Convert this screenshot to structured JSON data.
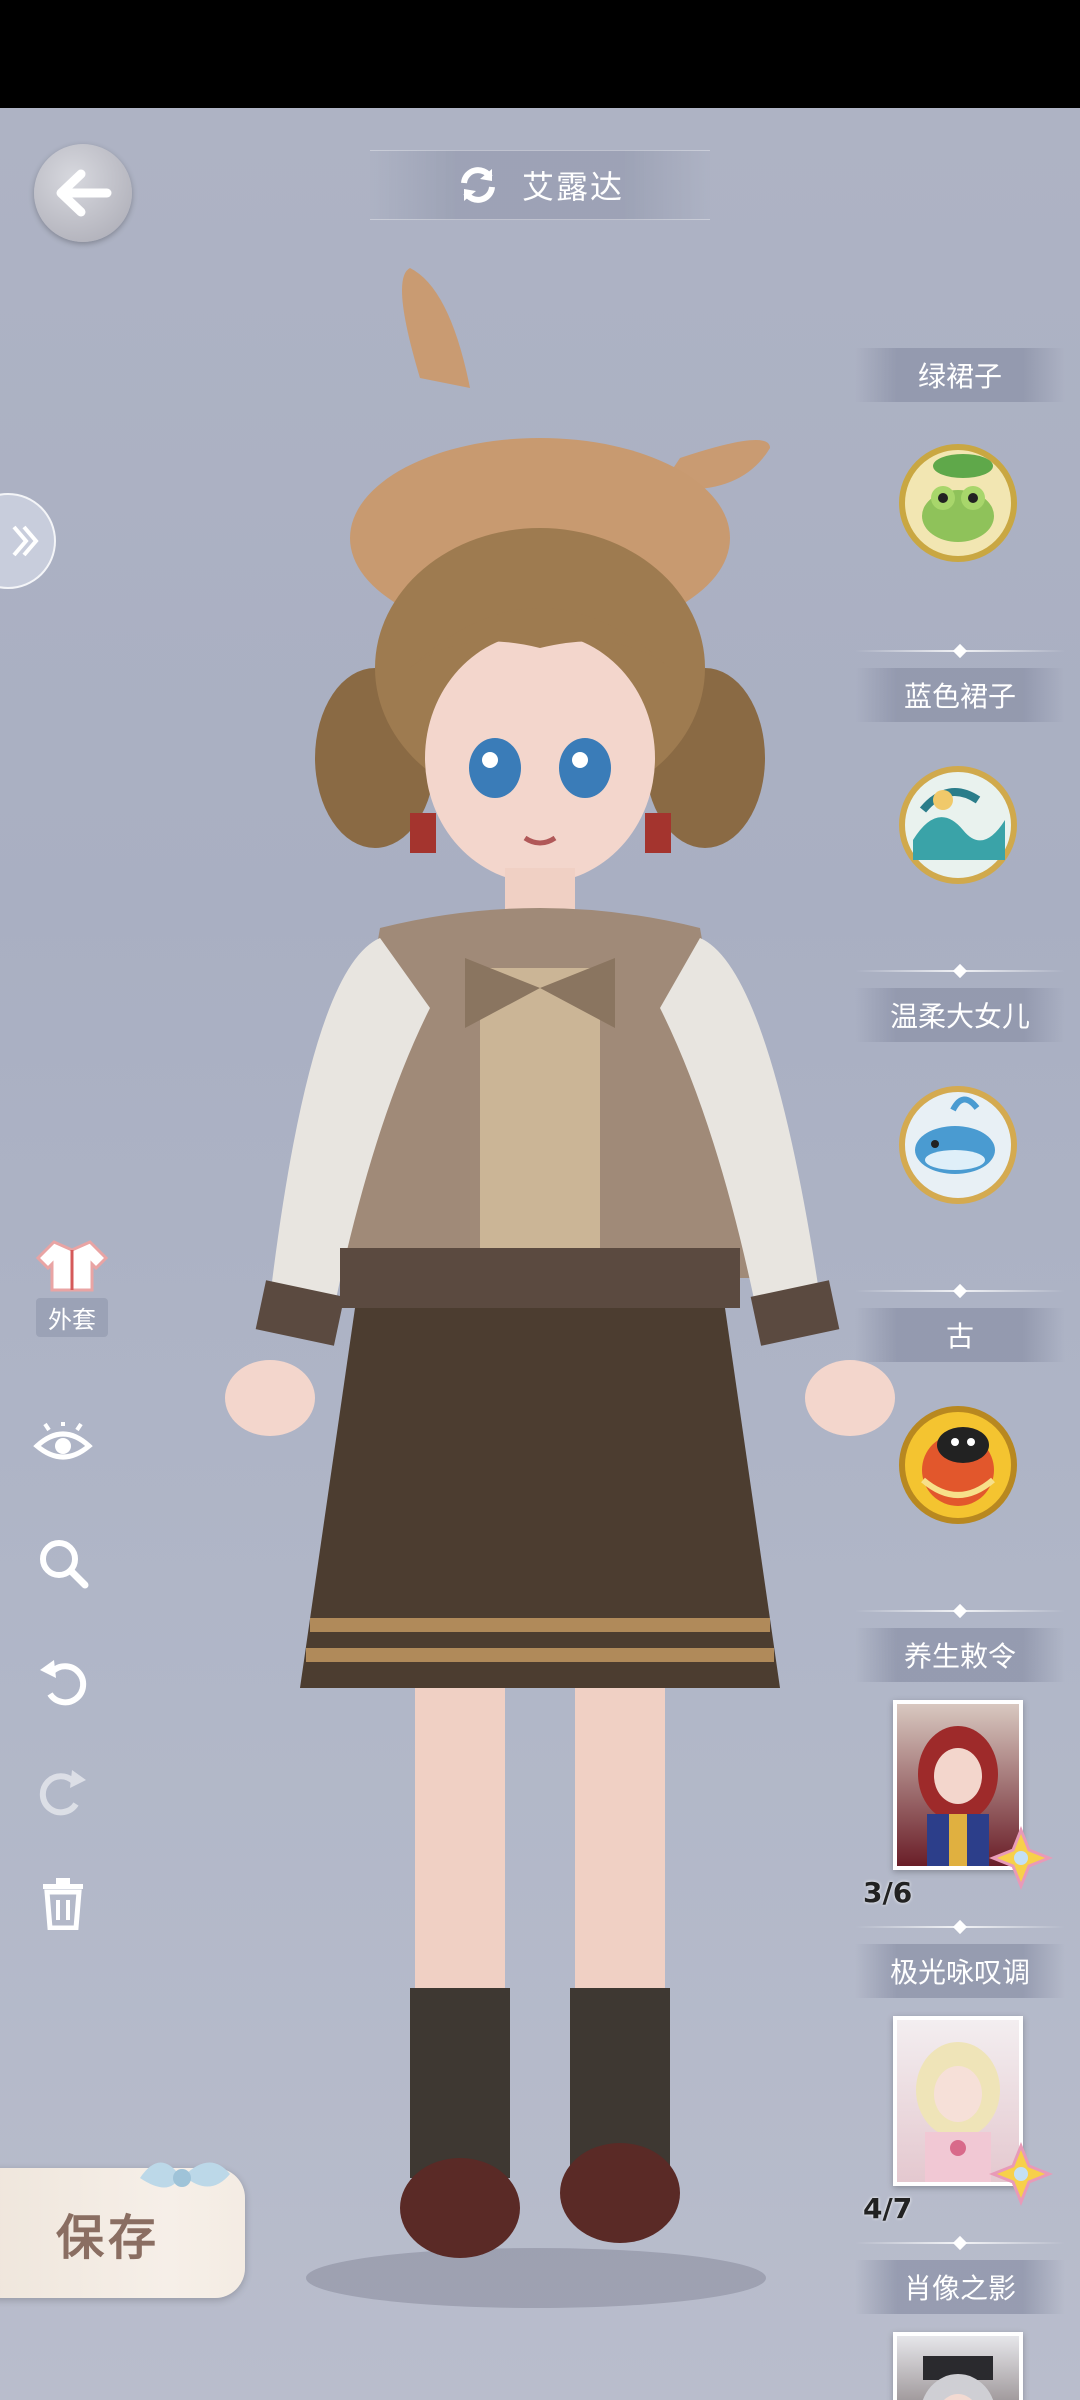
{
  "header": {
    "title": "艾露达"
  },
  "left_tools": {
    "coat_label": "外套"
  },
  "right_column": {
    "sections": [
      {
        "label": "绿裙子",
        "kind": "badge",
        "icon": "frog-badge-icon"
      },
      {
        "label": "蓝色裙子",
        "kind": "badge",
        "icon": "wave-fish-badge-icon"
      },
      {
        "label": "温柔大女儿",
        "kind": "badge",
        "icon": "whale-badge-icon"
      },
      {
        "label": "古",
        "kind": "badge",
        "icon": "cat-badge-icon"
      },
      {
        "label": "养生敕令",
        "kind": "portrait",
        "count": "3/6"
      },
      {
        "label": "极光咏叹调",
        "kind": "portrait",
        "count": "4/7"
      },
      {
        "label": "肖像之影",
        "kind": "portrait"
      }
    ]
  },
  "footer": {
    "save_label": "保存"
  },
  "colors": {
    "background": "#aeb3c4",
    "save_text": "#8a6e62",
    "label_text": "#ffffff"
  }
}
